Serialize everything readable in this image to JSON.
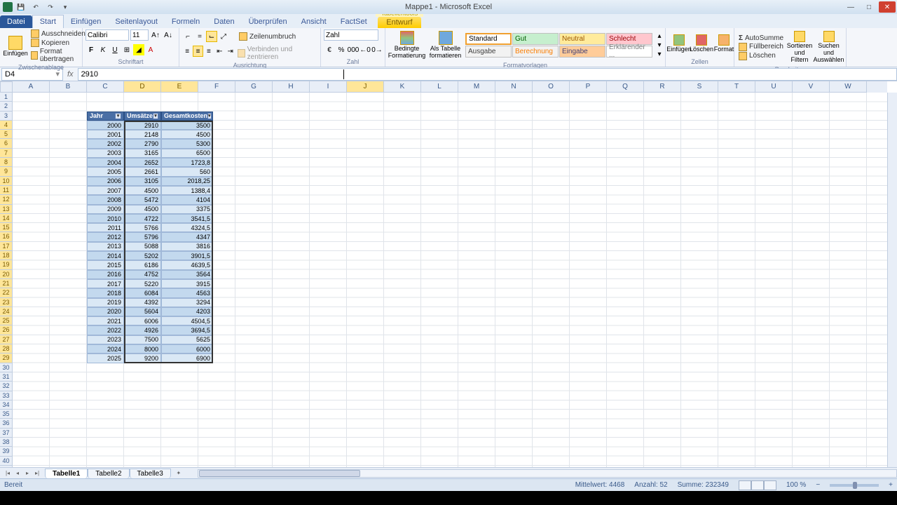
{
  "window": {
    "title": "Mappe1 - Microsoft Excel",
    "context_tool_label": "Tabellentools"
  },
  "tabs": {
    "file": "Datei",
    "items": [
      "Start",
      "Einfügen",
      "Seitenlayout",
      "Formeln",
      "Daten",
      "Überprüfen",
      "Ansicht",
      "FactSet",
      "Entwurf"
    ]
  },
  "ribbon": {
    "clipboard": {
      "paste": "Einfügen",
      "cut": "Ausschneiden",
      "copy": "Kopieren",
      "format_painter": "Format übertragen",
      "label": "Zwischenablage"
    },
    "font": {
      "name": "Calibri",
      "size": "11",
      "label": "Schriftart"
    },
    "alignment": {
      "wrap": "Zeilenumbruch",
      "merge": "Verbinden und zentrieren",
      "label": "Ausrichtung"
    },
    "number": {
      "format": "Zahl",
      "label": "Zahl"
    },
    "styles": {
      "conditional": "Bedingte Formatierung",
      "as_table": "Als Tabelle formatieren",
      "cells": [
        {
          "label": "Standard",
          "bg": "#ffffff",
          "color": "#000"
        },
        {
          "label": "Gut",
          "bg": "#c6efce",
          "color": "#006100"
        },
        {
          "label": "Neutral",
          "bg": "#ffeb9c",
          "color": "#9c5700"
        },
        {
          "label": "Schlecht",
          "bg": "#ffc7ce",
          "color": "#9c0006"
        },
        {
          "label": "Ausgabe",
          "bg": "#f2f2f2",
          "color": "#3f3f3f"
        },
        {
          "label": "Berechnung",
          "bg": "#f2f2f2",
          "color": "#fa7d00"
        },
        {
          "label": "Eingabe",
          "bg": "#ffcc99",
          "color": "#3f3f76"
        },
        {
          "label": "Erklärender ...",
          "bg": "#ffffff",
          "color": "#7f7f7f"
        }
      ],
      "label": "Formatvorlagen"
    },
    "cells_group": {
      "insert": "Einfügen",
      "delete": "Löschen",
      "format": "Format",
      "label": "Zellen"
    },
    "editing": {
      "autosum": "AutoSumme",
      "fill": "Füllbereich",
      "clear": "Löschen",
      "sort": "Sortieren und Filtern",
      "find": "Suchen und Auswählen",
      "label": "Bearbeiten"
    }
  },
  "formula_bar": {
    "cell_ref": "D4",
    "value": "2910"
  },
  "columns": [
    "A",
    "B",
    "C",
    "D",
    "E",
    "F",
    "G",
    "H",
    "I",
    "J",
    "K",
    "L",
    "M",
    "N",
    "O",
    "P",
    "Q",
    "R",
    "S",
    "T",
    "U",
    "V",
    "W"
  ],
  "table": {
    "headers": [
      "Jahr",
      "Umsätze",
      "Gesamtkosten"
    ],
    "rows": [
      [
        "2000",
        "2910",
        "3500"
      ],
      [
        "2001",
        "2148",
        "4500"
      ],
      [
        "2002",
        "2790",
        "5300"
      ],
      [
        "2003",
        "3165",
        "6500"
      ],
      [
        "2004",
        "2652",
        "1723,8"
      ],
      [
        "2005",
        "2661",
        "560"
      ],
      [
        "2006",
        "3105",
        "2018,25"
      ],
      [
        "2007",
        "4500",
        "1388,4"
      ],
      [
        "2008",
        "5472",
        "4104"
      ],
      [
        "2009",
        "4500",
        "3375"
      ],
      [
        "2010",
        "4722",
        "3541,5"
      ],
      [
        "2011",
        "5766",
        "4324,5"
      ],
      [
        "2012",
        "5796",
        "4347"
      ],
      [
        "2013",
        "5088",
        "3816"
      ],
      [
        "2014",
        "5202",
        "3901,5"
      ],
      [
        "2015",
        "6186",
        "4639,5"
      ],
      [
        "2016",
        "4752",
        "3564"
      ],
      [
        "2017",
        "5220",
        "3915"
      ],
      [
        "2018",
        "6084",
        "4563"
      ],
      [
        "2019",
        "4392",
        "3294"
      ],
      [
        "2020",
        "5604",
        "4203"
      ],
      [
        "2021",
        "6006",
        "4504,5"
      ],
      [
        "2022",
        "4926",
        "3694,5"
      ],
      [
        "2023",
        "7500",
        "5625"
      ],
      [
        "2024",
        "8000",
        "6000"
      ],
      [
        "2025",
        "9200",
        "6900"
      ]
    ]
  },
  "sheets": {
    "items": [
      "Tabelle1",
      "Tabelle2",
      "Tabelle3"
    ],
    "active": 0
  },
  "status": {
    "ready": "Bereit",
    "avg_label": "Mittelwert:",
    "avg_value": "4468",
    "count_label": "Anzahl:",
    "count_value": "52",
    "sum_label": "Summe:",
    "sum_value": "232349",
    "zoom": "100 %"
  }
}
